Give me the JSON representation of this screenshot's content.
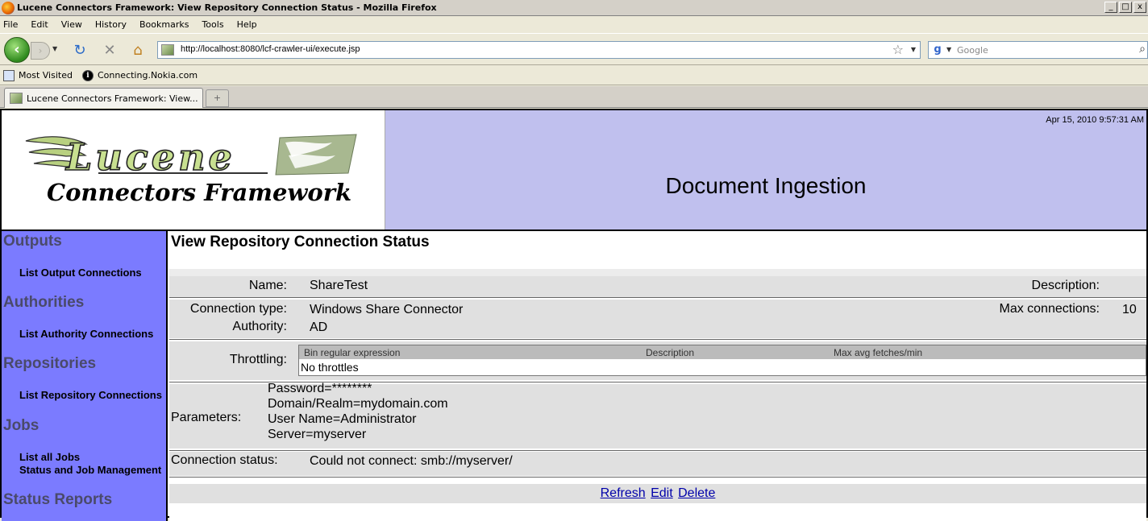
{
  "window": {
    "title": "Lucene Connectors Framework: View Repository Connection Status - Mozilla Firefox",
    "controls": [
      "_",
      "□",
      "x"
    ]
  },
  "menu": {
    "items": [
      {
        "label": "File"
      },
      {
        "label": "Edit"
      },
      {
        "label": "View"
      },
      {
        "label": "History"
      },
      {
        "label": "Bookmarks"
      },
      {
        "label": "Tools"
      },
      {
        "label": "Help"
      }
    ]
  },
  "navbar": {
    "url": "http://localhost:8080/lcf-crawler-ui/execute.jsp",
    "search_placeholder": "Google"
  },
  "bookmarks": {
    "items": [
      {
        "label": "Most Visited"
      },
      {
        "label": "Connecting.Nokia.com"
      }
    ]
  },
  "tabs": {
    "active_label": "Lucene Connectors Framework: View...",
    "new_tab": "+"
  },
  "header": {
    "logo_line1": "Lucene",
    "logo_line2": "Connectors Framework",
    "datetime": "Apr 15, 2010 9:57:31 AM",
    "title": "Document Ingestion"
  },
  "sidebar": {
    "sections": [
      {
        "heading": "Outputs",
        "links": [
          "List Output Connections"
        ]
      },
      {
        "heading": "Authorities",
        "links": [
          "List Authority Connections"
        ]
      },
      {
        "heading": "Repositories",
        "links": [
          "List Repository Connections"
        ]
      },
      {
        "heading": "Jobs",
        "links": [
          "List all Jobs",
          "Status and Job Management"
        ]
      },
      {
        "heading": "Status Reports",
        "links": []
      }
    ]
  },
  "main": {
    "title": "View Repository Connection Status",
    "name_label": "Name:",
    "name_value": "ShareTest",
    "description_label": "Description:",
    "description_value": "",
    "connection_type_label": "Connection type:",
    "connection_type_value": "Windows Share Connector",
    "max_connections_label": "Max connections:",
    "max_connections_value": "10",
    "authority_label": "Authority:",
    "authority_value": "AD",
    "throttling_label": "Throttling:",
    "throttling_columns": [
      "Bin regular expression",
      "Description",
      "Max avg fetches/min"
    ],
    "throttling_empty": "No throttles",
    "parameters_label": "Parameters:",
    "parameters": [
      "Password=********",
      "Domain/Realm=mydomain.com",
      "User Name=Administrator",
      "Server=myserver"
    ],
    "connection_status_label": "Connection status:",
    "connection_status_value": "Could not connect: smb://myserver/",
    "actions": [
      "Refresh",
      "Edit",
      "Delete"
    ]
  },
  "colors": {
    "header_bg": "#c0c0ee",
    "sidebar_bg": "#7b7bff",
    "sidebar_heading": "#4a4a6a",
    "link": "#0000aa"
  }
}
